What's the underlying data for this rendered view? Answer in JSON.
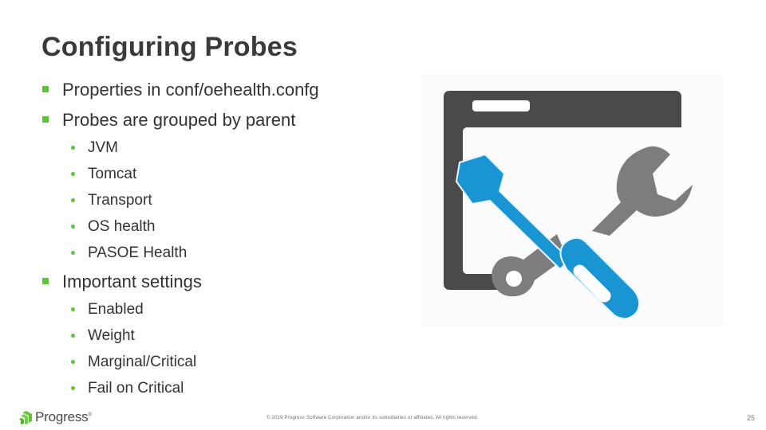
{
  "slide": {
    "title": "Configuring Probes",
    "bullets": [
      {
        "text": "Properties in conf/oehealth.confg",
        "children": []
      },
      {
        "text": "Probes are grouped by parent",
        "children": [
          "JVM",
          "Tomcat",
          "Transport",
          "OS health",
          "PASOE Health"
        ]
      },
      {
        "text": "Important settings",
        "children": [
          "Enabled",
          "Weight",
          "Marginal/Critical",
          "Fail on Critical"
        ]
      }
    ],
    "illustration": "window-with-screwdriver-and-wrench-icon"
  },
  "footer": {
    "logo_text": "Progress",
    "logo_mark": "®",
    "copyright": "© 2019 Progress Software Corporation and/or its subsidiaries or affiliates. All rights reserved.",
    "page_number": "25"
  },
  "colors": {
    "accent_green": "#5ec43a",
    "title_text": "#3a3a3c",
    "body_text": "#333333",
    "icon_dark": "#4a4a4a",
    "icon_gray": "#7a7a7a",
    "icon_blue": "#1a95d4"
  }
}
